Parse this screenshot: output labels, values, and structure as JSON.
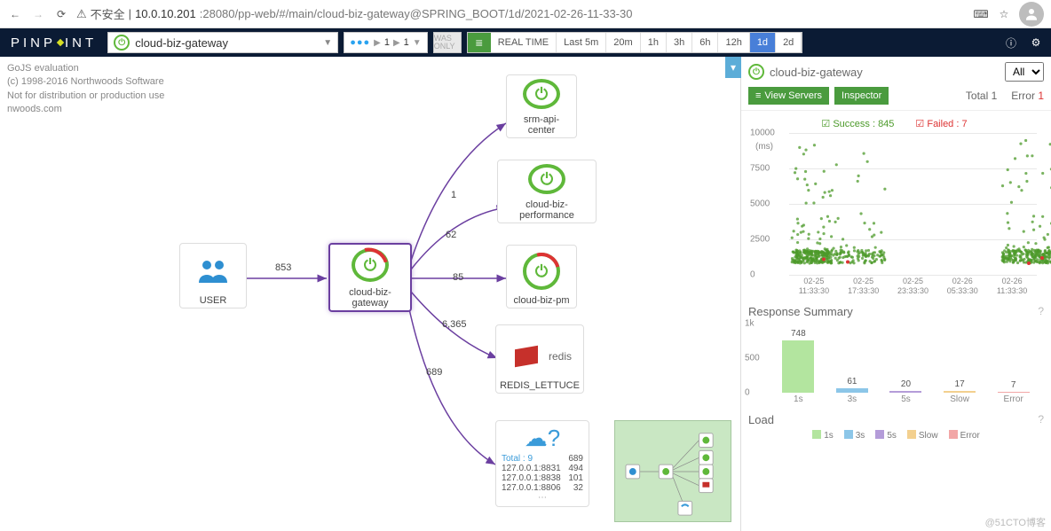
{
  "browser": {
    "insecure_label": "不安全",
    "host": "10.0.10.201",
    "port_path": ":28080/pp-web/#/main/cloud-biz-gateway@SPRING_BOOT/1d/2021-02-26-11-33-30"
  },
  "nav": {
    "logo": "PINP  INT",
    "app_selected": "cloud-biz-gateway",
    "inout_in": "1",
    "inout_out": "1",
    "was_only": "WAS ONLY",
    "realtime": "REAL TIME",
    "ranges": [
      "Last 5m",
      "20m",
      "1h",
      "3h",
      "6h",
      "12h",
      "1d",
      "2d"
    ],
    "range_selected": "1d"
  },
  "gojs": {
    "l1": "GoJS evaluation",
    "l2": "(c) 1998-2016 Northwoods Software",
    "l3": "Not for distribution or production use",
    "l4": "nwoods.com"
  },
  "graph": {
    "nodes": {
      "user": "USER",
      "gateway": "cloud-biz-gateway",
      "api": "srm-api-center",
      "perf": "cloud-biz-performance",
      "pm": "cloud-biz-pm",
      "redis_label": "redis",
      "redis_name": "REDIS_LETTUCE"
    },
    "edges": {
      "user_gw": "853",
      "gw_api": "1",
      "gw_perf": "62",
      "gw_pm": "85",
      "gw_redis": "6,365",
      "gw_cloud": "689"
    },
    "cloud": {
      "total_label": "Total : 9",
      "total_count": "689",
      "rows": [
        {
          "addr": "127.0.0.1:8831",
          "cnt": "494"
        },
        {
          "addr": "127.0.0.1:8838",
          "cnt": "101"
        },
        {
          "addr": "127.0.0.1:8806",
          "cnt": "32"
        }
      ]
    }
  },
  "panel": {
    "title": "cloud-biz-gateway",
    "filter": "All",
    "btn_view_servers": "View Servers",
    "btn_inspector": "Inspector",
    "total_label": "Total",
    "total_value": "1",
    "error_label": "Error",
    "error_value": "1",
    "success_label": "Success : 845",
    "failed_label": "Failed : 7"
  },
  "chart_data": {
    "type": "scatter",
    "title": "",
    "xlabel": "",
    "ylabel": "(ms)",
    "ylim": [
      0,
      10000
    ],
    "yticks": [
      0,
      2500,
      5000,
      7500,
      10000
    ],
    "xticks": [
      "02-25\n11:33:30",
      "02-25\n17:33:30",
      "02-25\n23:33:30",
      "02-26\n05:33:30",
      "02-26\n11:33:30"
    ],
    "series": [
      {
        "name": "Success",
        "color": "#4c9a2a",
        "count": 845
      },
      {
        "name": "Failed",
        "color": "#d33",
        "count": 7
      }
    ]
  },
  "response_summary": {
    "title": "Response Summary",
    "type": "bar",
    "categories": [
      "1s",
      "3s",
      "5s",
      "Slow",
      "Error"
    ],
    "values": [
      748,
      61,
      20,
      17,
      7
    ],
    "colors": [
      "#b3e59f",
      "#8cc6e8",
      "#b49cd9",
      "#f3d08f",
      "#f2a6a6"
    ],
    "ylim": [
      0,
      1000
    ],
    "yticks": [
      "0",
      "500",
      "1k"
    ]
  },
  "load": {
    "title": "Load"
  },
  "legend": {
    "l1s": "1s",
    "l3s": "3s",
    "l5s": "5s",
    "lslow": "Slow",
    "lerr": "Error"
  },
  "watermark": "@51CTO博客"
}
